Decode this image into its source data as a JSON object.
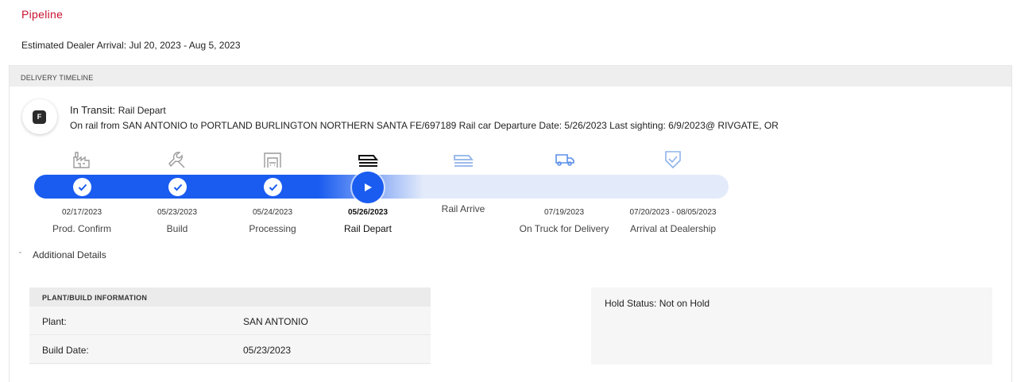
{
  "header": {
    "title": "Pipeline",
    "eta": "Estimated Dealer Arrival: Jul 20, 2023 - Aug 5, 2023"
  },
  "timeline": {
    "section_title": "DELIVERY TIMELINE",
    "badge_letter": "F",
    "status_label": "In Transit:",
    "status_value": "Rail Depart",
    "route_text": "On rail from SAN ANTONIO to PORTLAND BURLINGTON NORTHERN SANTA FE/697189 Rail car Departure Date: 5/26/2023 Last sighting: 6/9/2023@ RIVGATE, OR",
    "steps": [
      {
        "label": "Prod. Confirm",
        "date": "02/17/2023",
        "state": "complete",
        "icon": "factory-icon"
      },
      {
        "label": "Build",
        "date": "05/23/2023",
        "state": "complete",
        "icon": "wrench-icon"
      },
      {
        "label": "Processing",
        "date": "05/24/2023",
        "state": "complete",
        "icon": "garage-icon"
      },
      {
        "label": "Rail Depart",
        "date": "05/26/2023",
        "state": "current",
        "icon": "train-icon"
      },
      {
        "label": "Rail Arrive",
        "date": "",
        "state": "upcoming",
        "icon": "train-arrive-icon"
      },
      {
        "label": "On Truck for Delivery",
        "date": "07/19/2023",
        "state": "upcoming",
        "icon": "truck-icon"
      },
      {
        "label": "Arrival at Dealership",
        "date": "07/20/2023 - 08/05/2023",
        "state": "upcoming",
        "icon": "shield-check-icon"
      }
    ],
    "colors": {
      "active": "#1a5cf0",
      "track": "#e3ebfa",
      "complete_icon": "#9a9a9a",
      "upcoming_icon": "#8fb3ea"
    }
  },
  "details": {
    "toggle_label": "Additional Details",
    "plant": {
      "header": "PLANT/BUILD INFORMATION",
      "rows": [
        {
          "key": "Plant:",
          "value": "SAN ANTONIO"
        },
        {
          "key": "Build Date:",
          "value": "05/23/2023"
        }
      ]
    },
    "hold_status": "Hold Status: Not on Hold"
  }
}
